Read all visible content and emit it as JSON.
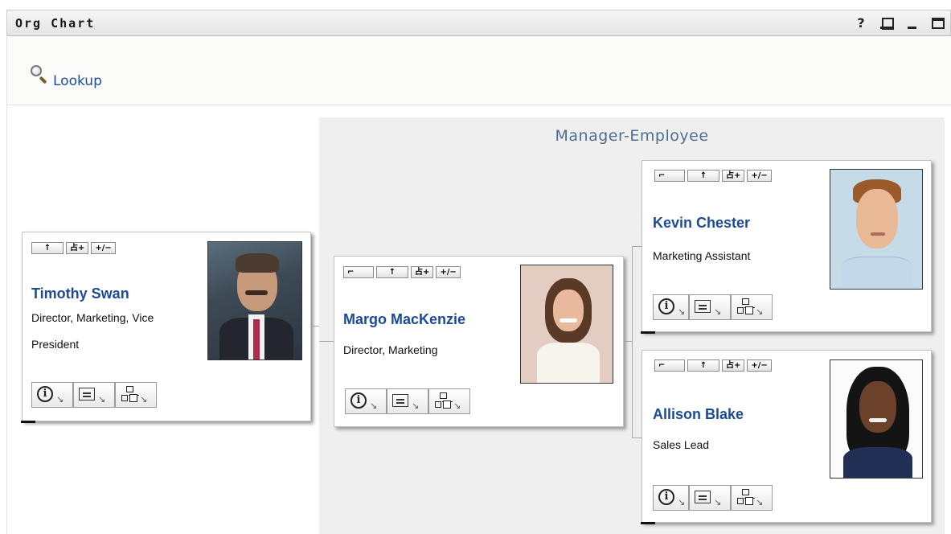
{
  "window": {
    "title": "Org Chart",
    "controls": {
      "help": "?",
      "print": "print",
      "minimize": "minimize",
      "maximize": "maximize"
    }
  },
  "toolbar": {
    "lookup_label": "Lookup"
  },
  "group": {
    "title": "Manager-Employee"
  },
  "card_buttons": {
    "up": "↑",
    "reports": "占+",
    "expand": "+/−",
    "manager": "⌐"
  },
  "people": {
    "timothy": {
      "name": "Timothy Swan",
      "title_line1": "Director, Marketing, Vice",
      "title_line2": "President"
    },
    "margo": {
      "name": "Margo MacKenzie",
      "title_line1": "Director, Marketing"
    },
    "kevin": {
      "name": "Kevin Chester",
      "title_line1": "Marketing Assistant"
    },
    "allison": {
      "name": "Allison Blake",
      "title_line1": "Sales Lead"
    }
  },
  "action_icons": [
    "info-icon",
    "vcard-icon",
    "org-chart-icon"
  ],
  "colors": {
    "name_link": "#1d4a96",
    "group_title": "#4d6f96",
    "group_bg": "#efefef"
  }
}
